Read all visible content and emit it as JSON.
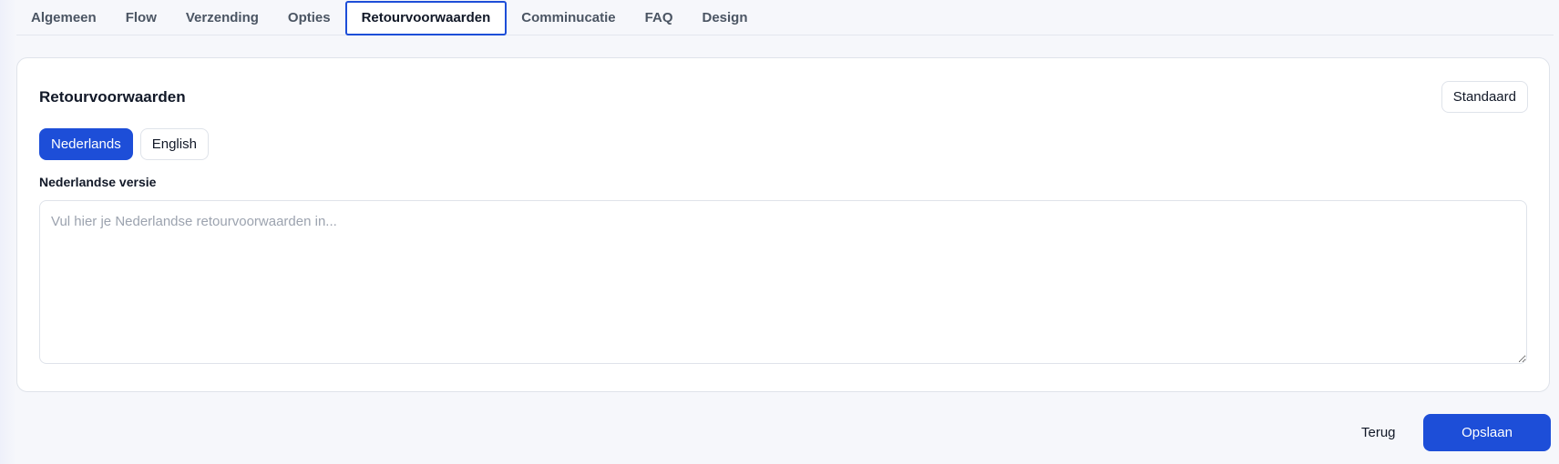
{
  "tabs": [
    {
      "label": "Algemeen",
      "active": false
    },
    {
      "label": "Flow",
      "active": false
    },
    {
      "label": "Verzending",
      "active": false
    },
    {
      "label": "Opties",
      "active": false
    },
    {
      "label": "Retourvoorwaarden",
      "active": true
    },
    {
      "label": "Comminucatie",
      "active": false
    },
    {
      "label": "FAQ",
      "active": false
    },
    {
      "label": "Design",
      "active": false
    }
  ],
  "card": {
    "title": "Retourvoorwaarden",
    "standard_label": "Standaard",
    "languages": [
      {
        "label": "Nederlands",
        "active": true
      },
      {
        "label": "English",
        "active": false
      }
    ],
    "field_label": "Nederlandse versie",
    "textarea": {
      "value": "",
      "placeholder": "Vul hier je Nederlandse retourvoorwaarden in..."
    }
  },
  "footer": {
    "back_label": "Terug",
    "save_label": "Opslaan"
  },
  "colors": {
    "accent": "#1d4ed8",
    "background": "#f6f7fb",
    "border": "#dfe3ea"
  }
}
